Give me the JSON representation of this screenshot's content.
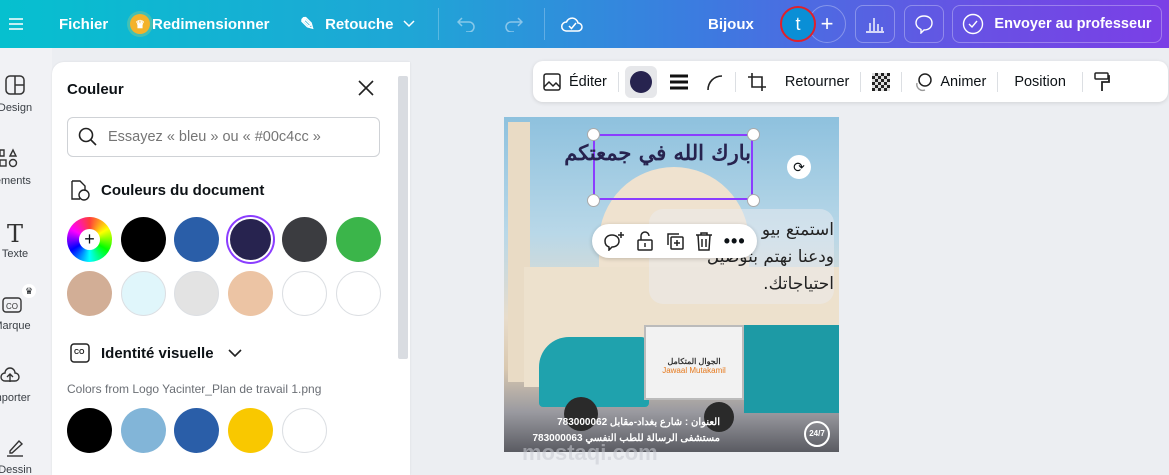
{
  "topbar": {
    "menu_icon": "hamburger-icon",
    "file": "Fichier",
    "resize": "Redimensionner",
    "edit": "Retouche",
    "project_name": "Bijoux",
    "avatar_letter": "t",
    "send": "Envoyer au professeur"
  },
  "rail": {
    "items": [
      {
        "label": "Design",
        "icon": "layout-icon"
      },
      {
        "label": "Éléments",
        "icon": "shapes-icon"
      },
      {
        "label": "Texte",
        "icon": "text-icon"
      },
      {
        "label": "Marque",
        "icon": "brand-icon"
      },
      {
        "label": "Importer",
        "icon": "upload-cloud-icon"
      },
      {
        "label": "Dessin",
        "icon": "draw-icon"
      }
    ]
  },
  "panel": {
    "title": "Couleur",
    "search_placeholder": "Essayez « bleu » ou « #00c4cc »",
    "doc_colors_title": "Couleurs du document",
    "doc_colors": [
      "#000000",
      "#2a5ea8",
      "#27234f",
      "#3b3c40",
      "#3bb54a",
      "#d2ae96",
      "#e0f6fb",
      "#e3e3e3",
      "#ecc4a4",
      "#ffffff",
      "#ffffff"
    ],
    "selected_color": "#27234f",
    "brand_title": "Identité visuelle",
    "logo_colors_label": "Colors from Logo Yacinter_Plan de travail 1.png",
    "logo_colors": [
      "#000000",
      "#82b5d8",
      "#2a5ea8",
      "#f9c800",
      "#ffffff"
    ]
  },
  "toolbar": {
    "edit": "Éditer",
    "flip": "Retourner",
    "animate": "Animer",
    "position": "Position",
    "current_color": "#27234f"
  },
  "design": {
    "headline": "بارك الله في جمعتكم",
    "body_lines": [
      "استمتع بيو",
      "ودعنا نهتم بتوصيل",
      "احتياجاتك."
    ],
    "truck_brand_ar": "الجوال المتكامل",
    "truck_brand_en": "Jawaal Mutakamil",
    "address": "العنوان : شارع بغداد-مقابل 783000062",
    "address2": "مستشفى الرسالة للطب النفسي 783000063",
    "badge": "24/7"
  },
  "watermark": "mostaqi.com"
}
